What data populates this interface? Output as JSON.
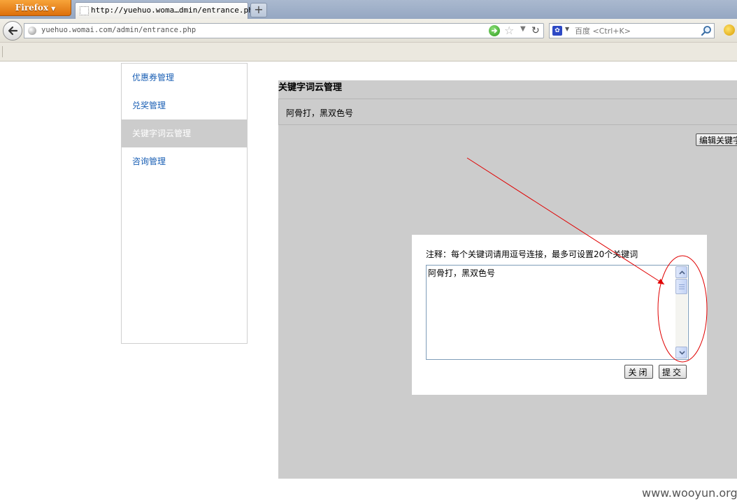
{
  "browser": {
    "menu_button_label": "Firefox",
    "menu_button_caret": "▼",
    "tab_title": "http://yuehuo.woma…dmin/entrance.php",
    "new_tab_label": "+",
    "url": "yuehuo.womai.com/admin/entrance.php",
    "search_placeholder": "百度 <Ctrl+K>",
    "search_engine_icon": "paw-icon",
    "colors": {
      "tab_bar": "#aab9cf",
      "firefox_button": "#e98a1f",
      "toolbar": "#ebe8df"
    }
  },
  "sidebar": {
    "items": [
      {
        "label": "优惠券管理",
        "active": false
      },
      {
        "label": "兑奖管理",
        "active": false
      },
      {
        "label": "关键字词云管理",
        "active": true
      },
      {
        "label": "咨询管理",
        "active": false
      }
    ]
  },
  "main": {
    "title": "关键字词云管理",
    "keywords": "阿骨打，黑双色号",
    "edit_button_label": "编辑关键字"
  },
  "dialog": {
    "note": "注释：每个关键词请用逗号连接，最多可设置20个关键词",
    "textarea_value": "阿骨打，黑双色号",
    "close_label": "关闭",
    "submit_label": "提交"
  },
  "annotation": {
    "color": "#e00000",
    "type": "arrow-and-ellipse"
  },
  "watermark": "www.wooyun.org",
  "colors": {
    "panel_gray": "#cccccc",
    "link_blue": "#1a5fb4",
    "active_item_bg": "#cccccc"
  }
}
